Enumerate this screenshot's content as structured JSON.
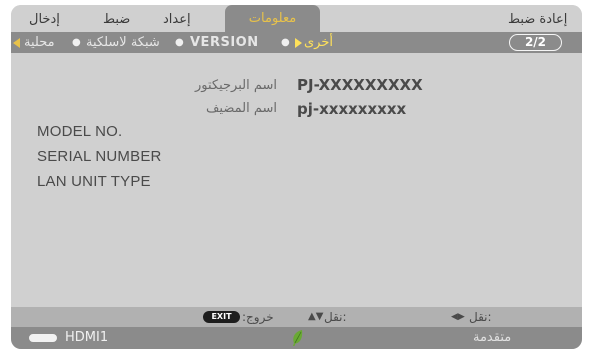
{
  "tabs": [
    {
      "label": "إدخال"
    },
    {
      "label": "ضبط"
    },
    {
      "label": "إعداد"
    },
    {
      "label": "معلومات"
    },
    {
      "label": "إعادة ضبط"
    }
  ],
  "subtabs": [
    {
      "label": "محلية"
    },
    {
      "label": "شبكة لاسلكية"
    },
    {
      "label": "VERSION"
    },
    {
      "label": "أخرى"
    }
  ],
  "page_indicator": "2/2",
  "rows": [
    {
      "label": "اسم البرجيكتور",
      "value": "PJ-XXXXXXXXX"
    },
    {
      "label": "اسم المضيف",
      "value": "pj-xxxxxxxxx"
    }
  ],
  "info_labels": [
    "MODEL NO.",
    "SERIAL NUMBER",
    "LAN UNIT TYPE"
  ],
  "footer": {
    "exit_key": "EXIT",
    "exit_label": ":خروج",
    "move_vertical_label": "نقل:",
    "move_horizontal_label": "نقل:",
    "vertical_arrows": "▲▼",
    "horizontal_arrows": "◀▶"
  },
  "status": {
    "source": "HDMI1",
    "mode": "متقدمة"
  },
  "colors": {
    "active_tab_text": "#e8c24a",
    "active_subtab_text": "#ffe15a",
    "eco_leaf": "#6aa935"
  }
}
